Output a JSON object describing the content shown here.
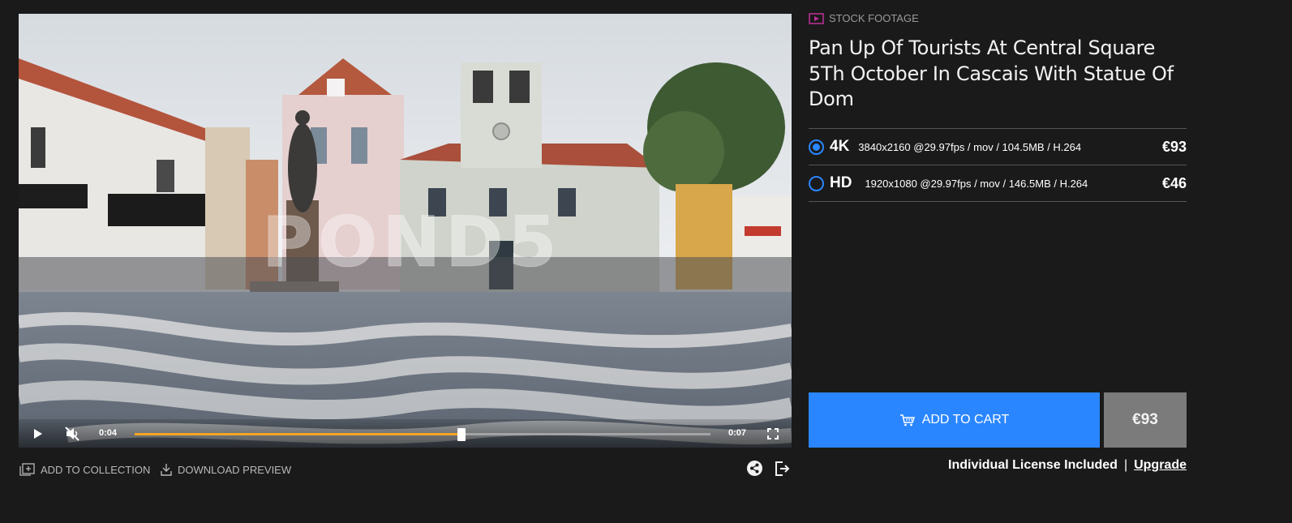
{
  "player": {
    "watermark": "POND5",
    "current_time": "0:04",
    "duration": "0:07",
    "progress_fraction": 0.567,
    "muted": true,
    "accent_color": "#f5a623"
  },
  "actions": {
    "add_to_collection": "ADD TO COLLECTION",
    "download_preview": "DOWNLOAD PREVIEW",
    "share_icon": "share-icon",
    "open_icon": "open-external-icon"
  },
  "product": {
    "category": "STOCK FOOTAGE",
    "category_color": "#c0309a",
    "title": "Pan Up Of Tourists At Central Square 5Th October In Cascais With Statue Of Dom"
  },
  "options": [
    {
      "label": "4K",
      "spec": "3840x2160 @29.97fps / mov / 104.5MB / H.264",
      "price": "€93",
      "selected": true
    },
    {
      "label": "HD",
      "spec": "1920x1080 @29.97fps / mov / 146.5MB / H.264",
      "price": "€46",
      "selected": false
    }
  ],
  "cart": {
    "button_label": "ADD TO CART",
    "price": "€93",
    "button_color": "#2a86ff"
  },
  "license": {
    "text": "Individual License Included",
    "separator": "|",
    "upgrade_label": "Upgrade"
  }
}
